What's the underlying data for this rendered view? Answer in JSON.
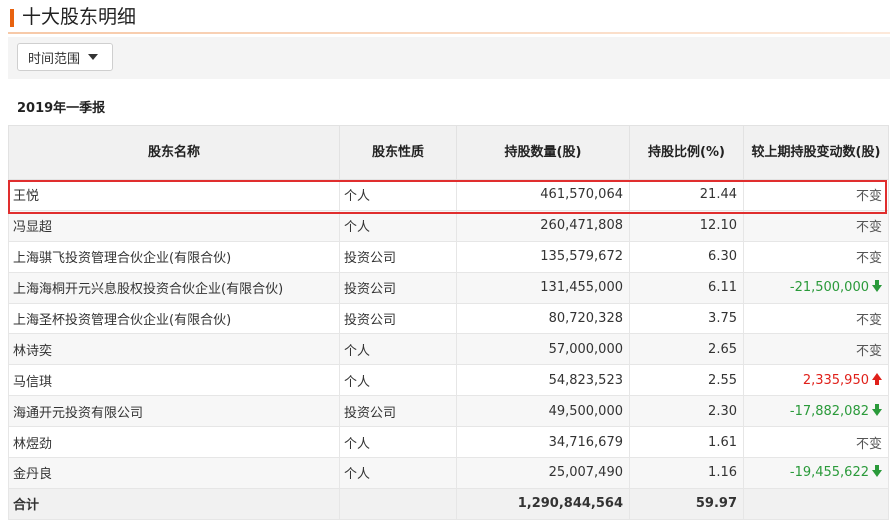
{
  "header": {
    "title": "十大股东明细"
  },
  "filter": {
    "label": "时间范围"
  },
  "period": "2019年一季报",
  "table": {
    "columns": [
      "股东名称",
      "股东性质",
      "持股数量(股)",
      "持股比例(%)",
      "较上期持股变动数(股)"
    ],
    "rows": [
      {
        "name": "王悦",
        "type": "个人",
        "shares": "461,570,064",
        "ratio": "21.44",
        "change": "不变",
        "trend": "none"
      },
      {
        "name": "冯显超",
        "type": "个人",
        "shares": "260,471,808",
        "ratio": "12.10",
        "change": "不变",
        "trend": "none"
      },
      {
        "name": "上海骐飞投资管理合伙企业(有限合伙)",
        "type": "投资公司",
        "shares": "135,579,672",
        "ratio": "6.30",
        "change": "不变",
        "trend": "none"
      },
      {
        "name": "上海海桐开元兴息股权投资合伙企业(有限合伙)",
        "type": "投资公司",
        "shares": "131,455,000",
        "ratio": "6.11",
        "change": "-21,500,000",
        "trend": "down"
      },
      {
        "name": "上海圣杯投资管理合伙企业(有限合伙)",
        "type": "投资公司",
        "shares": "80,720,328",
        "ratio": "3.75",
        "change": "不变",
        "trend": "none"
      },
      {
        "name": "林诗奕",
        "type": "个人",
        "shares": "57,000,000",
        "ratio": "2.65",
        "change": "不变",
        "trend": "none"
      },
      {
        "name": "马信琪",
        "type": "个人",
        "shares": "54,823,523",
        "ratio": "2.55",
        "change": "2,335,950",
        "trend": "up"
      },
      {
        "name": "海通开元投资有限公司",
        "type": "投资公司",
        "shares": "49,500,000",
        "ratio": "2.30",
        "change": "-17,882,082",
        "trend": "down"
      },
      {
        "name": "林煜劲",
        "type": "个人",
        "shares": "34,716,679",
        "ratio": "1.61",
        "change": "不变",
        "trend": "none"
      },
      {
        "name": "金丹良",
        "type": "个人",
        "shares": "25,007,490",
        "ratio": "1.16",
        "change": "-19,455,622",
        "trend": "down"
      }
    ],
    "total": {
      "label": "合计",
      "shares": "1,290,844,564",
      "ratio": "59.97"
    }
  },
  "colors": {
    "accent": "#e8620f",
    "up": "#e0201a",
    "down": "#2a9a3a",
    "highlight": "#e02e2e"
  },
  "icons": {
    "down": "arrow-down-icon",
    "up": "arrow-up-icon",
    "dropdown": "caret-down-icon"
  }
}
